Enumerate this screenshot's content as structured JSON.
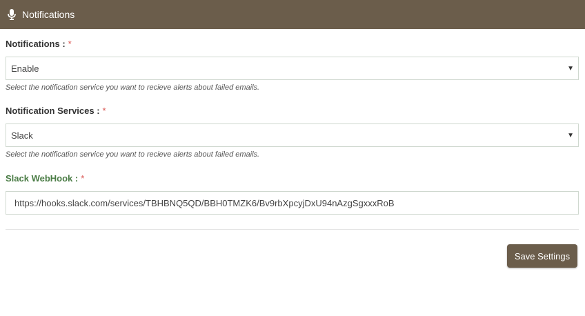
{
  "header": {
    "title": "Notifications",
    "icon": "microphone-icon",
    "bg_color": "#6b5d4b"
  },
  "fields": {
    "notifications": {
      "label": "Notifications :",
      "required": "*",
      "value": "Enable",
      "help": "Select the notification service you want to recieve alerts about failed emails."
    },
    "services": {
      "label": "Notification Services :",
      "required": "*",
      "value": "Slack",
      "help": "Select the notification service you want to recieve alerts about failed emails."
    },
    "webhook": {
      "label": "Slack WebHook :",
      "required": "*",
      "value": "https://hooks.slack.com/services/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RoB"
    }
  },
  "actions": {
    "save_label": "Save Settings"
  },
  "colors": {
    "accent": "#6b5d4b",
    "required": "#d9534f",
    "webhook_label": "#4a7c45"
  }
}
